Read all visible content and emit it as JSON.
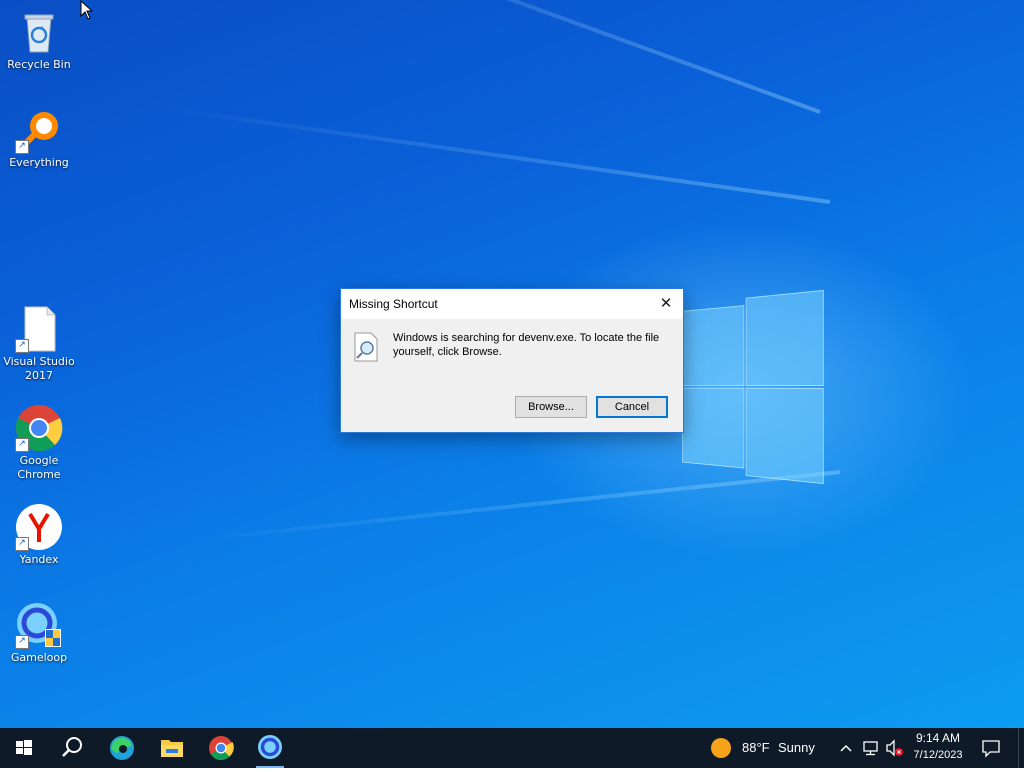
{
  "desktop_icons": [
    {
      "label": "Recycle Bin"
    },
    {
      "label": "Everything"
    },
    {
      "label": "Visual Studio 2017"
    },
    {
      "label": "Google Chrome"
    },
    {
      "label": "Yandex"
    },
    {
      "label": "Gameloop"
    }
  ],
  "dialog": {
    "title": "Missing Shortcut",
    "close_glyph": "✕",
    "message": "Windows is searching for devenv.exe. To locate the file yourself, click Browse.",
    "browse_label": "Browse...",
    "cancel_label": "Cancel"
  },
  "taskbar": {
    "apps": [
      "start",
      "search",
      "edge",
      "file-explorer",
      "chrome",
      "gameloop"
    ],
    "weather_temp": "88°F",
    "weather_desc": "Sunny",
    "time": "9:14 AM",
    "date": "7/12/2023"
  },
  "colors": {
    "accent": "#0078d7",
    "taskbar": "#0f1a28",
    "desktop": "#0b7fe8"
  }
}
